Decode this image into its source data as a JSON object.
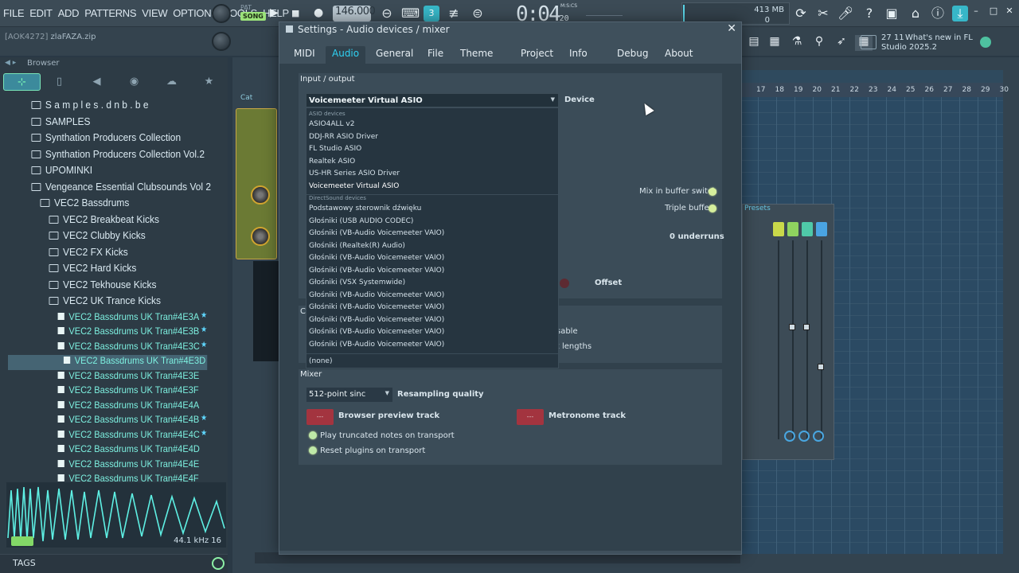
{
  "menu": [
    "FILE",
    "EDIT",
    "ADD",
    "PATTERNS",
    "VIEW",
    "OPTIONS",
    "TOOLS",
    "HELP"
  ],
  "transport": {
    "pat_label": "PAT",
    "song_label": "SONG",
    "tempo": "146.000",
    "time": "0:04",
    "time_sub": "20",
    "time_unit": "M:S:CS",
    "pattern_num": "3",
    "memory": "413 MB",
    "cpu": "0"
  },
  "hint_bar": {
    "tag": "[AOK4272]",
    "file": "zlaFAZA.zip"
  },
  "news": {
    "number": "27 11",
    "text1": "What's new in FL",
    "text2": "Studio 2025.2"
  },
  "browser": {
    "title": "Browser",
    "items": [
      {
        "type": "folder",
        "indent": 2,
        "label": "S a m p l e s . d n b . b e"
      },
      {
        "type": "folder",
        "indent": 2,
        "label": "SAMPLES"
      },
      {
        "type": "folder",
        "indent": 2,
        "label": "Synthation Producers Collection"
      },
      {
        "type": "folder",
        "indent": 2,
        "label": "Synthation Producers Collection Vol.2"
      },
      {
        "type": "folder",
        "indent": 2,
        "label": "UPOMINKI"
      },
      {
        "type": "folder",
        "indent": 2,
        "label": "Vengeance Essential Clubsounds Vol 2"
      },
      {
        "type": "folder",
        "indent": 3,
        "label": "VEC2 Bassdrums"
      },
      {
        "type": "folder",
        "indent": 4,
        "label": "VEC2 Breakbeat Kicks"
      },
      {
        "type": "folder",
        "indent": 4,
        "label": "VEC2 Clubby Kicks"
      },
      {
        "type": "folder",
        "indent": 4,
        "label": "VEC2 FX Kicks"
      },
      {
        "type": "folder",
        "indent": 4,
        "label": "VEC2 Hard Kicks"
      },
      {
        "type": "folder",
        "indent": 4,
        "label": "VEC2 Tekhouse Kicks"
      },
      {
        "type": "folder",
        "indent": 4,
        "label": "VEC2 UK Trance Kicks"
      },
      {
        "type": "file",
        "indent": 5,
        "label": "VEC2 Bassdrums UK Tran#4E3A",
        "star": true
      },
      {
        "type": "file",
        "indent": 5,
        "label": "VEC2 Bassdrums UK Tran#4E3B",
        "star": true
      },
      {
        "type": "file",
        "indent": 5,
        "label": "VEC2 Bassdrums UK Tran#4E3C",
        "star": true
      },
      {
        "type": "file",
        "indent": 5,
        "label": "VEC2 Bassdrums UK Tran#4E3D",
        "selected": true
      },
      {
        "type": "file",
        "indent": 5,
        "label": "VEC2 Bassdrums UK Tran#4E3E"
      },
      {
        "type": "file",
        "indent": 5,
        "label": "VEC2 Bassdrums UK Tran#4E3F"
      },
      {
        "type": "file",
        "indent": 5,
        "label": "VEC2 Bassdrums UK Tran#4E4A"
      },
      {
        "type": "file",
        "indent": 5,
        "label": "VEC2 Bassdrums UK Tran#4E4B",
        "star": true
      },
      {
        "type": "file",
        "indent": 5,
        "label": "VEC2 Bassdrums UK Tran#4E4C",
        "star": true
      },
      {
        "type": "file",
        "indent": 5,
        "label": "VEC2 Bassdrums UK Tran#4E4D"
      },
      {
        "type": "file",
        "indent": 5,
        "label": "VEC2 Bassdrums UK Tran#4E4E"
      },
      {
        "type": "file",
        "indent": 5,
        "label": "VEC2 Bassdrums UK Tran#4E4F"
      }
    ],
    "sample_rate": "44.1 kHz 16",
    "tags_label": "TAGS"
  },
  "ruler": [
    "17",
    "18",
    "19",
    "20",
    "21",
    "22",
    "23",
    "24",
    "25",
    "26",
    "27",
    "28",
    "29",
    "30"
  ],
  "mixer_title": "Presets",
  "plugin_tab": "Cat",
  "dialog": {
    "title": "Settings - Audio devices / mixer",
    "tabs": [
      {
        "label": "MIDI",
        "active": false
      },
      {
        "label": "Audio",
        "active": true
      },
      {
        "label": "General",
        "active": false
      },
      {
        "label": "File",
        "active": false
      },
      {
        "label": "Theme",
        "active": false
      },
      {
        "label": "Project",
        "active": false
      },
      {
        "label": "Info",
        "active": false
      },
      {
        "label": "Debug",
        "active": false
      },
      {
        "label": "About",
        "active": false
      }
    ],
    "input_output_label": "Input / output",
    "device_selected": "Voicemeeter Virtual ASIO",
    "device_label": "Device",
    "mix_in_buffer_switch": "Mix in buffer switch",
    "triple_buffer": "Triple buffer",
    "underruns": "0 underruns",
    "offset": "Offset",
    "partial_c": "C",
    "partial_sable": "sable",
    "partial_lengths": "k lengths",
    "mixer_label": "Mixer",
    "resampling_value": "512-point sinc",
    "resampling_label": "Resampling quality",
    "route_placeholder": "---",
    "browser_preview_track": "Browser preview track",
    "metronome_track": "Metronome track",
    "play_truncated": "Play truncated notes on transport",
    "reset_plugins": "Reset plugins on transport",
    "dropdown": {
      "asio_header": "ASIO devices",
      "asio": [
        "ASIO4ALL v2",
        "DDJ-RR ASIO Driver",
        "FL Studio ASIO",
        "Realtek ASIO",
        "US-HR Series ASIO Driver",
        "Voicemeeter Virtual ASIO"
      ],
      "ds_header": "DirectSound devices",
      "ds": [
        "Podstawowy sterownik dźwięku",
        "Głośniki (USB AUDIO  CODEC)",
        "Głośniki (VB-Audio Voicemeeter VAIO)",
        "Głośniki (Realtek(R) Audio)",
        "Głośniki (VB-Audio Voicemeeter VAIO)",
        "Głośniki (VB-Audio Voicemeeter VAIO)",
        "Głośniki (VSX Systemwide)",
        "Głośniki (VB-Audio Voicemeeter VAIO)",
        "Głośniki (VB-Audio Voicemeeter VAIO)",
        "Głośniki (VB-Audio Voicemeeter VAIO)",
        "Głośniki (VB-Audio Voicemeeter VAIO)",
        "Głośniki (VB-Audio Voicemeeter VAIO)"
      ],
      "none": "(none)"
    }
  },
  "colors": {
    "accent": "#2fd1f2",
    "panel": "#31414c",
    "led": "#d6ef9c",
    "route": "#a3343f"
  }
}
